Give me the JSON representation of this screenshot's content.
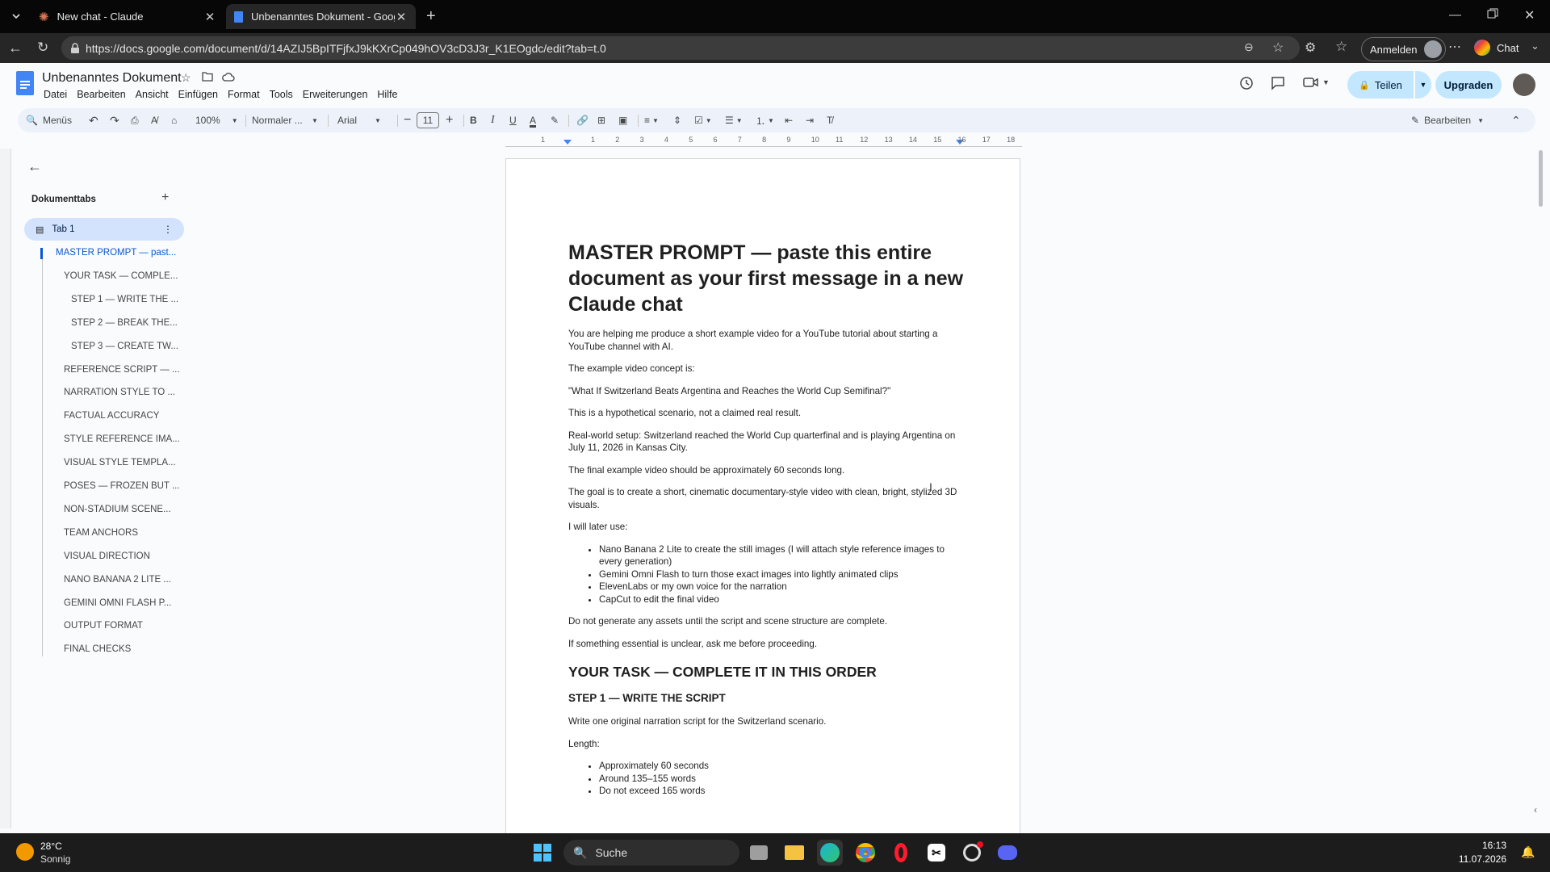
{
  "browser": {
    "tabs": [
      {
        "title": "New chat - Claude",
        "active": false
      },
      {
        "title": "Unbenanntes Dokument - Google",
        "active": true
      }
    ],
    "url": "https://docs.google.com/document/d/14AZIJ5BpITFjfxJ9kKXrCp049hOV3cD3J3r_K1EOgdc/edit?tab=t.0",
    "signin_label": "Anmelden",
    "chat_label": "Chat"
  },
  "docs": {
    "title": "Unbenanntes Dokument",
    "menu": [
      "Datei",
      "Bearbeiten",
      "Ansicht",
      "Einfügen",
      "Format",
      "Tools",
      "Erweiterungen",
      "Hilfe"
    ],
    "share_label": "Teilen",
    "upgrade_label": "Upgraden",
    "toolbar": {
      "menus_label": "Menüs",
      "zoom": "100%",
      "style": "Normaler ...",
      "font": "Arial",
      "font_size": "11",
      "edit_mode": "Bearbeiten"
    }
  },
  "sidebar": {
    "header": "Dokumenttabs",
    "tab_name": "Tab 1",
    "outline": [
      {
        "label": "MASTER PROMPT — past...",
        "level": 1,
        "active": true
      },
      {
        "label": "YOUR TASK — COMPLE...",
        "level": 2
      },
      {
        "label": "STEP 1 — WRITE THE ...",
        "level": 3
      },
      {
        "label": "STEP 2 — BREAK THE...",
        "level": 3
      },
      {
        "label": "STEP 3 — CREATE TW...",
        "level": 3
      },
      {
        "label": "REFERENCE SCRIPT — ...",
        "level": 2
      },
      {
        "label": "NARRATION STYLE TO ...",
        "level": 2
      },
      {
        "label": "FACTUAL ACCURACY",
        "level": 2
      },
      {
        "label": "STYLE REFERENCE IMA...",
        "level": 2
      },
      {
        "label": "VISUAL STYLE TEMPLA...",
        "level": 2
      },
      {
        "label": "POSES — FROZEN BUT ...",
        "level": 2
      },
      {
        "label": "NON-STADIUM SCENE...",
        "level": 2
      },
      {
        "label": "TEAM ANCHORS",
        "level": 2
      },
      {
        "label": "VISUAL DIRECTION",
        "level": 2
      },
      {
        "label": "NANO BANANA 2 LITE ...",
        "level": 2
      },
      {
        "label": "GEMINI OMNI FLASH P...",
        "level": 2
      },
      {
        "label": "OUTPUT FORMAT",
        "level": 2
      },
      {
        "label": "FINAL CHECKS",
        "level": 2
      }
    ]
  },
  "ruler": {
    "ticks": [
      "1",
      "1",
      "2",
      "3",
      "4",
      "5",
      "6",
      "7",
      "8",
      "9",
      "10",
      "11",
      "12",
      "13",
      "14",
      "15",
      "16",
      "17",
      "18"
    ]
  },
  "document": {
    "title": "MASTER PROMPT — paste this entire document as your first message in a new Claude chat",
    "p1": "You are helping me produce a short example video for a YouTube tutorial about starting a YouTube channel with AI.",
    "p2": "The example video concept is:",
    "p3": "\"What If Switzerland Beats Argentina and Reaches the World Cup Semifinal?\"",
    "p4": "This is a hypothetical scenario, not a claimed real result.",
    "p5": "Real-world setup: Switzerland reached the World Cup quarterfinal and is playing Argentina on July 11, 2026 in Kansas City.",
    "p6": "The final example video should be approximately 60 seconds long.",
    "p7": "The goal is to create a short, cinematic documentary-style video with clean, bright, stylized 3D visuals.",
    "p8": "I will later use:",
    "tools": [
      "Nano Banana 2 Lite to create the still images (I will attach style reference images to every generation)",
      "Gemini Omni Flash to turn those exact images into lightly animated clips",
      "ElevenLabs or my own voice for the narration",
      "CapCut to edit the final video"
    ],
    "p9": "Do not generate any assets until the script and scene structure are complete.",
    "p10": "If something essential is unclear, ask me before proceeding.",
    "h2": "YOUR TASK — COMPLETE IT IN THIS ORDER",
    "h3": "STEP 1 — WRITE THE SCRIPT",
    "p11": "Write one original narration script for the Switzerland scenario.",
    "p12": "Length:",
    "length": [
      "Approximately 60 seconds",
      "Around 135–155 words",
      "Do not exceed 165 words"
    ]
  },
  "taskbar": {
    "temperature": "28°C",
    "weather": "Sonnig",
    "search_label": "Suche",
    "time": "16:13",
    "date": "11.07.2026"
  },
  "colors": {
    "accent": "#0b57d0",
    "share_bg": "#c2e7ff",
    "docs_blue": "#4285f4"
  }
}
